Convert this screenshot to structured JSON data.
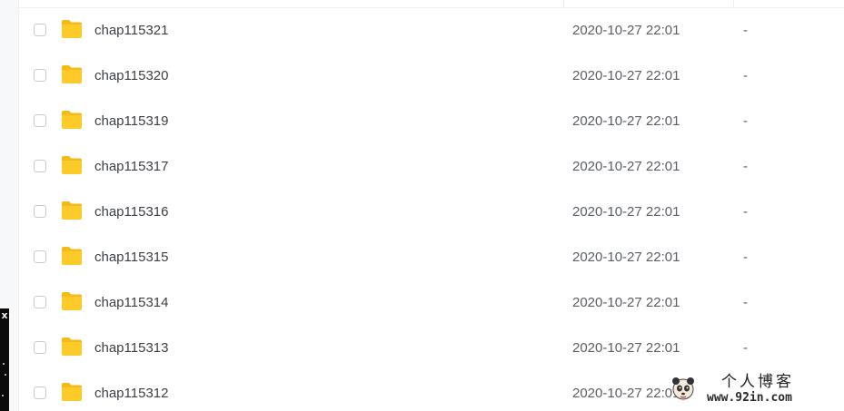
{
  "file_list": {
    "rows": [
      {
        "name": "chap115321",
        "modified": "2020-10-27 22:01",
        "size": "-",
        "icon": "folder-icon"
      },
      {
        "name": "chap115320",
        "modified": "2020-10-27 22:01",
        "size": "-",
        "icon": "folder-icon"
      },
      {
        "name": "chap115319",
        "modified": "2020-10-27 22:01",
        "size": "-",
        "icon": "folder-icon"
      },
      {
        "name": "chap115317",
        "modified": "2020-10-27 22:01",
        "size": "-",
        "icon": "folder-icon"
      },
      {
        "name": "chap115316",
        "modified": "2020-10-27 22:01",
        "size": "-",
        "icon": "folder-icon"
      },
      {
        "name": "chap115315",
        "modified": "2020-10-27 22:01",
        "size": "-",
        "icon": "folder-icon"
      },
      {
        "name": "chap115314",
        "modified": "2020-10-27 22:01",
        "size": "-",
        "icon": "folder-icon"
      },
      {
        "name": "chap115313",
        "modified": "2020-10-27 22:01",
        "size": "-",
        "icon": "folder-icon"
      },
      {
        "name": "chap115312",
        "modified": "2020-10-27 22:01",
        "size": "-",
        "icon": "folder-icon"
      }
    ]
  },
  "watermark": {
    "title": "个人博客",
    "url": "www.92in.com"
  },
  "colors": {
    "folder": "#fcca29",
    "folder_tab": "#f5b918",
    "checkbox_border": "#c7cbd2",
    "name_text": "#3c4046",
    "meta_text": "#5a5f66"
  },
  "left_strip": {
    "mark": "x"
  }
}
